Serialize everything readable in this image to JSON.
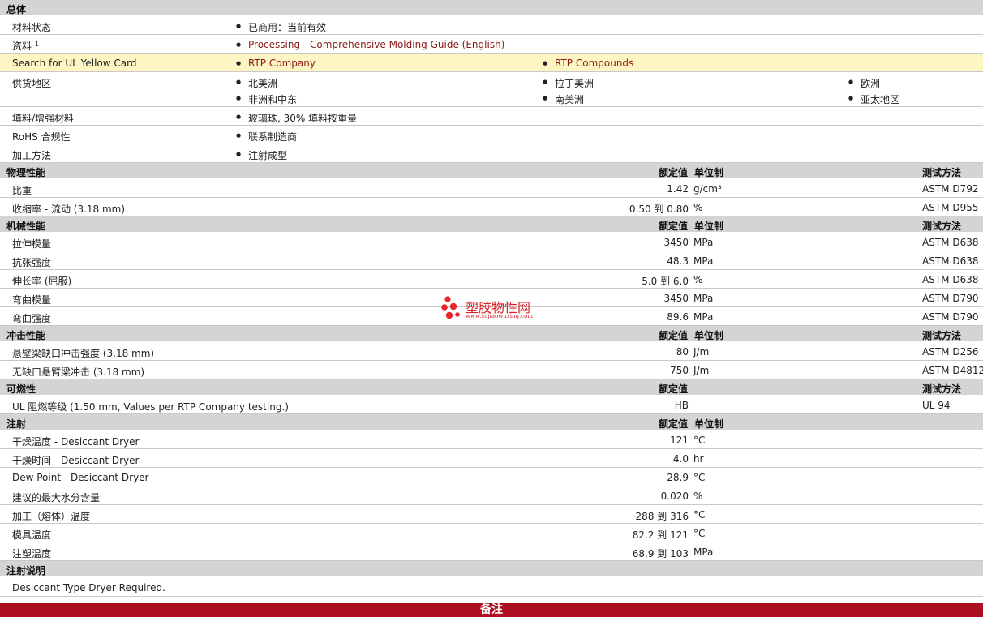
{
  "general": {
    "title": "总体",
    "rows": [
      {
        "label": "材料状态",
        "items": [
          {
            "text": "已商用：当前有效",
            "col": 1
          }
        ]
      },
      {
        "label": "资料",
        "sup": "1",
        "items": [
          {
            "text": "Processing - Comprehensive Molding Guide (English)",
            "col": 1,
            "link": true
          }
        ]
      },
      {
        "label": "Search for UL Yellow Card",
        "highlight": true,
        "items": [
          {
            "text": "RTP Company",
            "col": 1,
            "link": true
          },
          {
            "text": "RTP Compounds",
            "col": 2,
            "link": true
          }
        ]
      },
      {
        "label": "供货地区",
        "items": [
          {
            "text": "北美洲",
            "col": 1
          },
          {
            "text": "拉丁美洲",
            "col": 2
          },
          {
            "text": "欧洲",
            "col": 3
          },
          {
            "text": "非洲和中东",
            "col": 1,
            "row": 2
          },
          {
            "text": "南美洲",
            "col": 2,
            "row": 2
          },
          {
            "text": "亚太地区",
            "col": 3,
            "row": 2
          }
        ]
      },
      {
        "label": "填料/增强材料",
        "items": [
          {
            "text": "玻璃珠, 30% 填料按重量",
            "col": 1
          }
        ]
      },
      {
        "label": "RoHS 合规性",
        "items": [
          {
            "text": "联系制造商",
            "col": 1
          }
        ]
      },
      {
        "label": "加工方法",
        "items": [
          {
            "text": "注射成型",
            "col": 1
          }
        ]
      }
    ]
  },
  "sections": [
    {
      "title": "物理性能",
      "value_header": "额定值",
      "unit_header": "单位制",
      "method_header": "测试方法",
      "rows": [
        {
          "label": "比重",
          "value": "1.42",
          "unit": "g/cm³",
          "method": "ASTM D792"
        },
        {
          "label": "收缩率  - 流动  (3.18 mm)",
          "value": "0.50 到  0.80",
          "unit": "%",
          "method": "ASTM D955"
        }
      ]
    },
    {
      "title": "机械性能",
      "value_header": "额定值",
      "unit_header": "单位制",
      "method_header": "测试方法",
      "rows": [
        {
          "label": "拉伸模量",
          "value": "3450",
          "unit": "MPa",
          "method": "ASTM D638"
        },
        {
          "label": "抗张强度",
          "value": "48.3",
          "unit": "MPa",
          "method": "ASTM D638"
        },
        {
          "label": "伸长率  (屈服)",
          "value": "5.0 到  6.0",
          "unit": "%",
          "method": "ASTM D638"
        },
        {
          "label": "弯曲模量",
          "value": "3450",
          "unit": "MPa",
          "method": "ASTM D790"
        },
        {
          "label": "弯曲强度",
          "value": "89.6",
          "unit": "MPa",
          "method": "ASTM D790"
        }
      ]
    },
    {
      "title": "冲击性能",
      "value_header": "额定值",
      "unit_header": "单位制",
      "method_header": "测试方法",
      "rows": [
        {
          "label": "悬壁梁缺口冲击强度  (3.18 mm)",
          "value": "80",
          "unit": "J/m",
          "method": "ASTM D256"
        },
        {
          "label": "无缺口悬臂梁冲击  (3.18 mm)",
          "value": "750",
          "unit": "J/m",
          "method": "ASTM D4812"
        }
      ]
    },
    {
      "title": "可燃性",
      "value_header": "额定值",
      "unit_header": "",
      "method_header": "测试方法",
      "rows": [
        {
          "label": "UL 阻燃等级  (1.50 mm, Values per RTP Company testing.)",
          "value": "HB",
          "unit": "",
          "method": "UL 94"
        }
      ]
    },
    {
      "title": "注射",
      "value_header": "额定值",
      "unit_header": "单位制",
      "method_header": "",
      "rows": [
        {
          "label": "干燥温度  - Desiccant Dryer",
          "value": "121",
          "unit": "°C",
          "method": ""
        },
        {
          "label": "干燥时间  - Desiccant Dryer",
          "value": "4.0",
          "unit": "hr",
          "method": ""
        },
        {
          "label": "Dew Point - Desiccant Dryer",
          "value": "-28.9",
          "unit": "°C",
          "method": ""
        },
        {
          "label": "建议的最大水分含量",
          "value": "0.020",
          "unit": "%",
          "method": ""
        },
        {
          "label": "加工（熔体）温度",
          "value": "288 到  316",
          "unit": "°C",
          "method": ""
        },
        {
          "label": "模具温度",
          "value": "82.2 到  121",
          "unit": "°C",
          "method": ""
        },
        {
          "label": "注塑温度",
          "value": "68.9 到  103",
          "unit": "MPa",
          "method": ""
        }
      ]
    }
  ],
  "injection_notes": {
    "title": "注射说明",
    "text": "Desiccant Type Dryer Required."
  },
  "footer": {
    "label": "备注"
  },
  "watermark": {
    "title": "塑胶物性网",
    "url": "www.sujiaowuxing.com"
  },
  "colors": {
    "header_bg": "#d4d4d4",
    "highlight_bg": "#fdf6c2",
    "link": "#8b1a1a",
    "footer_bg": "#ad1020",
    "watermark": "#d6232b"
  }
}
